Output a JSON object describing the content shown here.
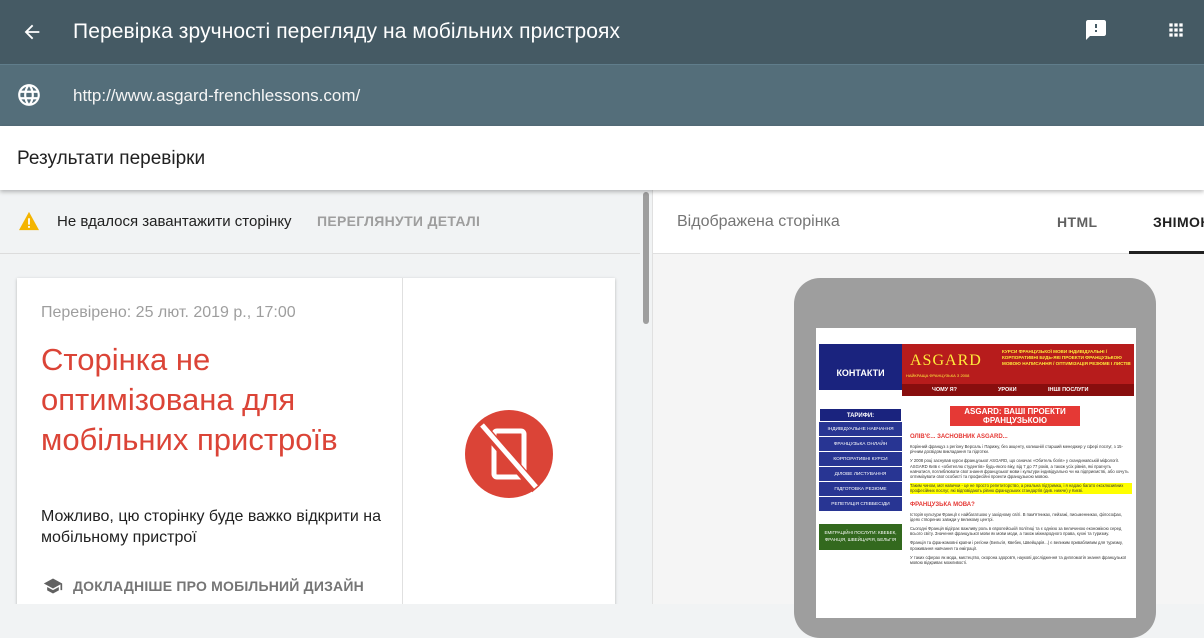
{
  "topbar": {
    "title": "Перевірка зручності перегляду на мобільних пристроях"
  },
  "urlbar": {
    "url": "http://www.asgard-frenchlessons.com/"
  },
  "results": {
    "title": "Результати перевірки"
  },
  "warning": {
    "text": "Не вдалося завантажити сторінку",
    "link": "ПЕРЕГЛЯНУТИ ДЕТАЛІ"
  },
  "card": {
    "checked": "Перевірено: 25 лют. 2019 р., 17:00",
    "headline": "Сторінка не оптимізована для мобільних пристроїв",
    "description": "Можливо, цю сторінку буде важко відкрити на мобільному пристрої",
    "more": "ДОКЛАДНІШЕ ПРО МОБІЛЬНИЙ ДИЗАЙН"
  },
  "preview": {
    "title": "Відображена сторінка",
    "tab_html": "HTML",
    "tab_snapshot": "ЗНІМОК"
  },
  "site": {
    "contacts": "КОНТАКТИ",
    "logo": "ASGARD",
    "logo_sub": "НАЙКРАЩА ФРАНЦУЗЬКА З 2008",
    "head_lines": "КУРСИ ФРАНЦУЗЬКОЇ МОВИ ІНДИВІДУАЛЬНІ / КОРПОРАТИВНІ БУДЬ-ЯКІ ПРОЕКТИ ФРАНЦУЗЬКОЮ МОВОЮ НАПИСАННЯ / ОПТИМІЗАЦІЯ РЕЗЮМЕ І ЛИСТІВ",
    "nav": [
      "ЧОМУ Я?",
      "УРОКИ",
      "ІНШІ ПОСЛУГИ"
    ],
    "menu_title": "ТАРИФИ:",
    "menu_items": [
      "ІНДИВІДУАЛЬНЕ НАВЧАННЯ",
      "ФРАНЦУЗЬКА ОНЛАЙН",
      "КОРПОРАТИВНІ КУРСИ",
      "ДІЛОВЕ ЛИСТУВАННЯ",
      "ПІДГОТОВКА РЕЗЮМЕ",
      "РЕПЕТИЦІЯ СПІВБЕСІДИ"
    ],
    "menu_green": "ЕМІГРАЦІЙНІ ПОСЛУГИ: КВЕБЕК, ФРАНЦІЯ, ШВЕЙЦАРІЯ, БЕЛЬГІЯ",
    "content_title": "ASGARD: ВАШІ ПРОЕКТИ ФРАНЦУЗЬКОЮ",
    "founder": "ОЛІВ'Є... ЗАСНОВНИК ASGARD...",
    "p1": "Корінний француз з регіону Версаль і Парижу, без акценту, колишній старший менеджер у сфері послуг, з 15-річним досвідом викладання та підготки.",
    "p2": "У 2008 році заснував курси французької ASGARD, що означає «Обитель богів» у скандинавській міфології. ASGARD Київ є «обителлю студентів» будь-якого віку, від 7 до 77 років, а також усіх рівнів, які прагнуть навчатися, поглиблювати свої знання французької мови і культури індивідуально чи на підприємстві, або хочуть оптимізувати свої особисті та професійні проекти французькою мовою.",
    "p3": "Таким чином, мої навички - це не просто репетиторство, а реальна підтримка, і я надаю багато ексклюзивних професійних послуг, які відповідають рівню французьких стандартів (див. нижче) у Києві.",
    "why": "ФРАНЦУЗЬКА МОВА?",
    "p4": "Історія культури Франції є найбагатшою у західному світі. В пам'ятниках, пейзажі, письменниках, філософах, ідеях створених завжди у великому центрі.",
    "p5": "Сьогодні Франція відіграє важливу роль в європейській політиці та є однією за величиною економікою серед всього світу. Значення французької мови як мови моди, а також міжнародного права, кухні та туризму.",
    "p6": "Франція та франкомовні країни і регіони (Бельгія, Квебек, Швейцарія...) є великим привабливим для туризму, проживання навчання та еміграції.",
    "p7": "У таких сферах як мода, мистецтво, охорона здоров'я, наукові дослідження та дипломатія знання французької мовою відкриває можливості."
  }
}
